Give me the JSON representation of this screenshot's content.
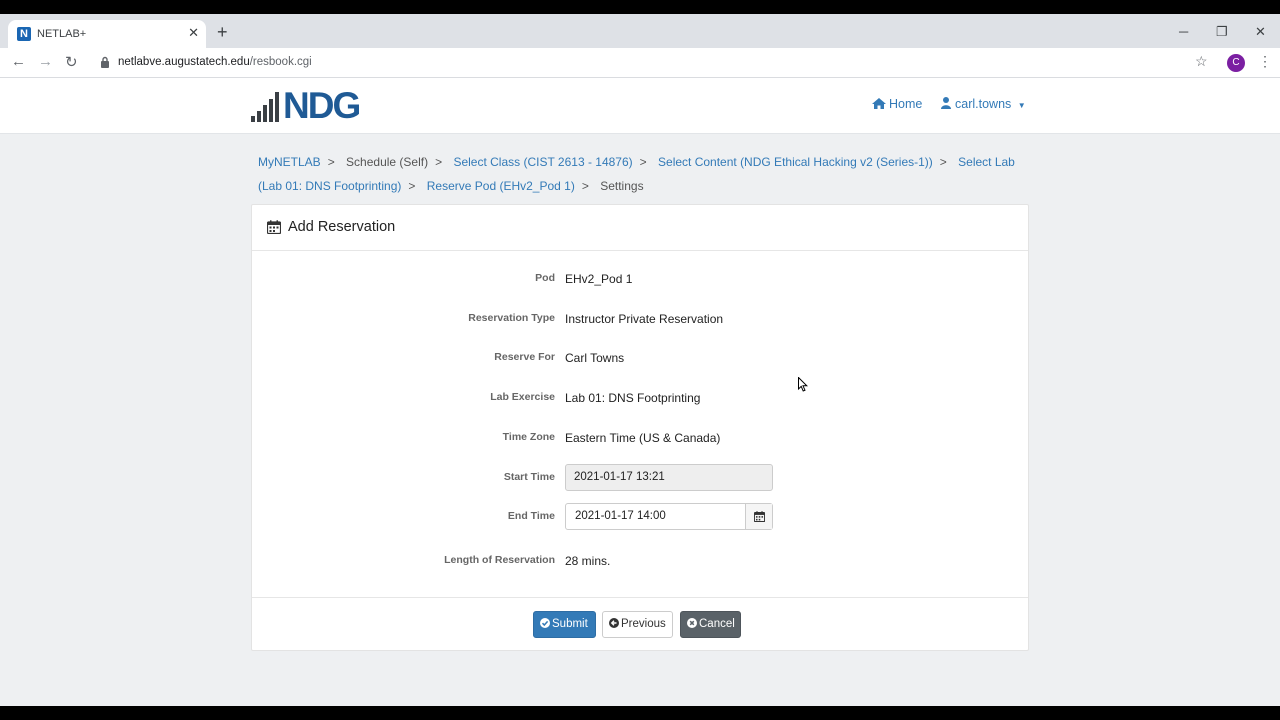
{
  "browser": {
    "tab_title": "NETLAB+",
    "tab_favicon_letter": "N",
    "url_host": "netlabve.augustatech.edu",
    "url_path": "/resbook.cgi",
    "profile_initial": "C"
  },
  "navbar": {
    "logo_text": "NDG",
    "home_label": "Home",
    "user_label": "carl.towns"
  },
  "breadcrumb": {
    "items": [
      {
        "label": "MyNETLAB"
      },
      {
        "label": "Schedule (Self)"
      },
      {
        "label": "Select Class (CIST 2613 - 14876)"
      },
      {
        "label": "Select Content (NDG Ethical Hacking v2 (Series-1))"
      },
      {
        "label": "Select Lab (Lab 01: DNS Footprinting)"
      },
      {
        "label": "Reserve Pod (EHv2_Pod 1)"
      },
      {
        "label": "Settings"
      }
    ]
  },
  "panel": {
    "title": "Add Reservation",
    "fields": {
      "pod": {
        "label": "Pod",
        "value": "EHv2_Pod 1"
      },
      "reservation_type": {
        "label": "Reservation Type",
        "value": "Instructor Private Reservation"
      },
      "reserve_for": {
        "label": "Reserve For",
        "value": "Carl Towns"
      },
      "lab_exercise": {
        "label": "Lab Exercise",
        "value": "Lab 01: DNS Footprinting"
      },
      "time_zone": {
        "label": "Time Zone",
        "value": "Eastern Time (US & Canada)"
      },
      "start_time": {
        "label": "Start Time",
        "value": "2021-01-17 13:21"
      },
      "end_time": {
        "label": "End Time",
        "value": "2021-01-17 14:00"
      },
      "length": {
        "label": "Length of Reservation",
        "value": "28 mins."
      }
    },
    "buttons": {
      "submit": "Submit",
      "previous": "Previous",
      "cancel": "Cancel"
    }
  },
  "colors": {
    "link": "#337ab7",
    "primary": "#337ab7",
    "secondary": "#5a6268",
    "logo": "#1f5a95"
  }
}
